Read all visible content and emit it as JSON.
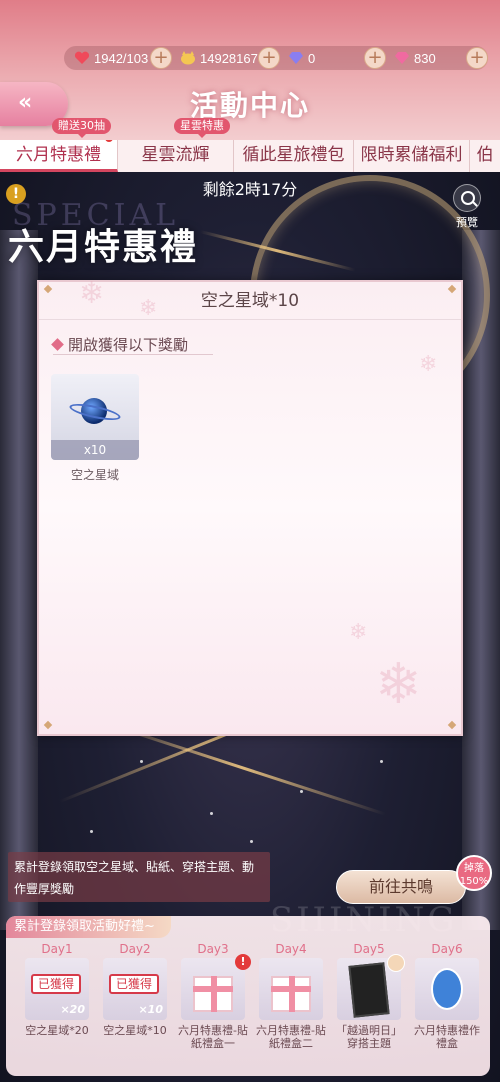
{
  "resources": {
    "stamina": "1942/103",
    "coins": "14928167",
    "diamonds_blue": "0",
    "diamonds_pink": "830"
  },
  "header": {
    "title": "活動中心"
  },
  "tabs": [
    {
      "label": "六月特惠禮",
      "badge": "贈送30抽",
      "active": true
    },
    {
      "label": "星雲流輝",
      "badge": "星雲特惠"
    },
    {
      "label": "循此星旅禮包"
    },
    {
      "label": "限時累儲福利"
    },
    {
      "label": "伯"
    }
  ],
  "event": {
    "timer": "剩餘2時17分",
    "bg_text": "SPECIAL",
    "title": "六月特惠禮",
    "preview_label": "預覽"
  },
  "modal": {
    "title": "空之星域*10",
    "section_label": "開啟獲得以下獎勵",
    "reward": {
      "name": "空之星域",
      "qty": "x10"
    }
  },
  "login": {
    "note": "累計登錄領取空之星域、貼紙、穿搭主題、動作豐厚獎勵",
    "go_button": "前往共鳴",
    "promo_badge": "掉落150%",
    "watermark": "SHINING"
  },
  "bottom": {
    "title": "累計登錄領取活動好禮~",
    "days": [
      {
        "label": "Day1",
        "name": "空之星域*20",
        "status": "已獲得",
        "qty": "×20"
      },
      {
        "label": "Day2",
        "name": "空之星域*10",
        "status": "已獲得",
        "qty": "×10"
      },
      {
        "label": "Day3",
        "name": "六月特惠禮-貼紙禮盒一"
      },
      {
        "label": "Day4",
        "name": "六月特惠禮-貼紙禮盒二"
      },
      {
        "label": "Day5",
        "name": "「越過明日」穿搭主題"
      },
      {
        "label": "Day6",
        "name": "六月特惠禮作禮盒"
      }
    ]
  },
  "colors": {
    "header_top": "#e07d88",
    "accent_red": "#e33a3a",
    "tab_text": "#8a3548"
  }
}
